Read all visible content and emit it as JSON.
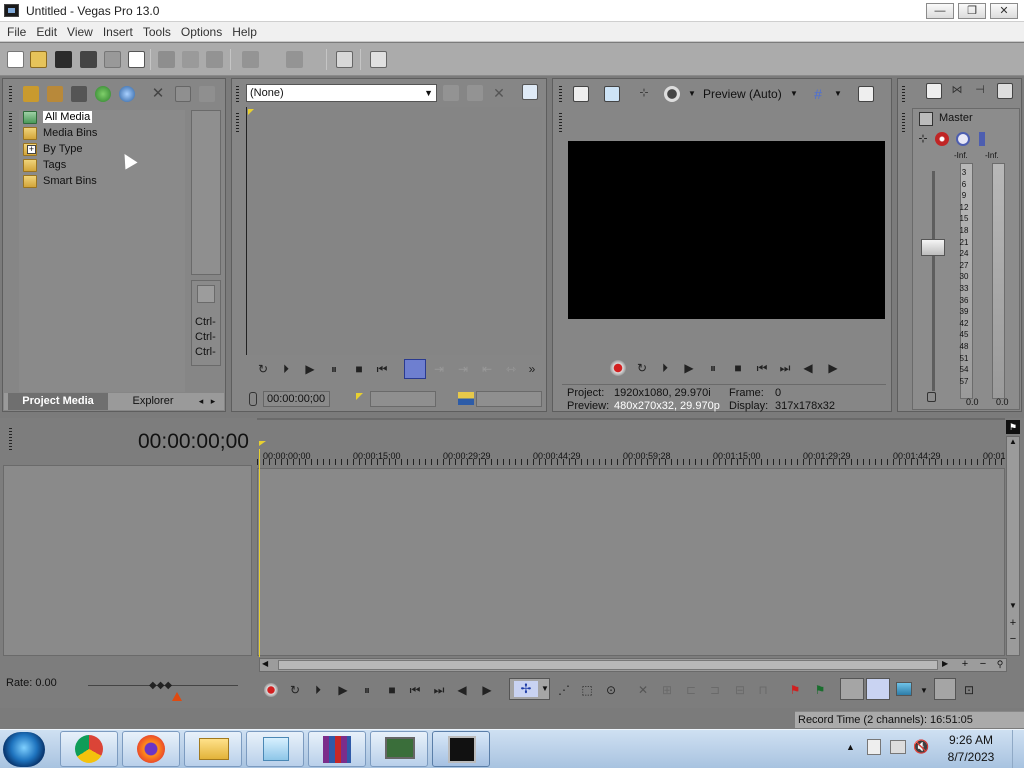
{
  "window": {
    "title": "Untitled - Vegas Pro 13.0",
    "min": "—",
    "max": "❐",
    "close": "✕"
  },
  "menu": [
    "File",
    "Edit",
    "View",
    "Insert",
    "Tools",
    "Options",
    "Help"
  ],
  "project_media": {
    "tree": [
      "All Media",
      "Media Bins",
      "By Type",
      "Tags",
      "Smart Bins"
    ],
    "expand": "+",
    "tabs": [
      "Project Media",
      "Explorer"
    ],
    "ctrl_labels": [
      "Ctrl-",
      "Ctrl-",
      "Ctrl-"
    ]
  },
  "trimmer": {
    "dropdown": "(None)",
    "timecode": "00:00:00;00"
  },
  "preview": {
    "mode": "Preview (Auto)",
    "project_label": "Project:",
    "project_value": "1920x1080, 29.970i",
    "preview_label": "Preview:",
    "preview_value": "480x270x32, 29.970p",
    "frame_label": "Frame:",
    "frame_value": "0",
    "display_label": "Display:",
    "display_value": "317x178x32"
  },
  "master": {
    "title": "Master",
    "inf_left": "-Inf.",
    "inf_right": "-Inf.",
    "scale": [
      "3",
      "6",
      "9",
      "12",
      "15",
      "18",
      "21",
      "24",
      "27",
      "30",
      "33",
      "36",
      "39",
      "42",
      "45",
      "48",
      "51",
      "54",
      "57"
    ],
    "bottom_left": "0.0",
    "bottom_right": "0.0"
  },
  "timeline": {
    "timecode": "00:00:00;00",
    "ruler": [
      "00:00:00;00",
      "00:00:15;00",
      "00:00:29;29",
      "00:00:44;29",
      "00:00:59;28",
      "00:01:15;00",
      "00:01:29;29",
      "00:01:44;29",
      "00:01:"
    ],
    "rate": "Rate: 0.00",
    "record_time": "Record Time (2 channels): 16:51:05"
  },
  "taskbar": {
    "time": "9:26 AM",
    "date": "8/7/2023"
  },
  "colors": {
    "panel": "#868686",
    "accent_record": "#d32020",
    "preview_bg": "#000000"
  }
}
